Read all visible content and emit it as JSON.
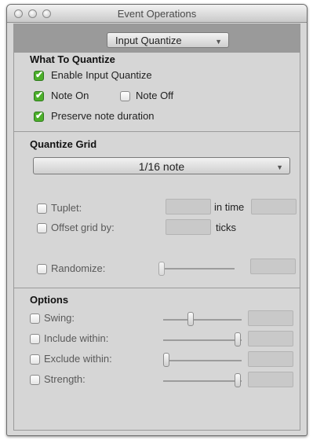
{
  "window": {
    "title": "Event Operations"
  },
  "operation": {
    "selected": "Input Quantize"
  },
  "what_to_quantize": {
    "title": "What To Quantize",
    "enable_input_quantize": {
      "label": "Enable Input Quantize",
      "checked": true
    },
    "note_on": {
      "label": "Note On",
      "checked": true
    },
    "note_off": {
      "label": "Note Off",
      "checked": false
    },
    "preserve_note_duration": {
      "label": "Preserve note duration",
      "checked": true
    }
  },
  "quantize_grid": {
    "title": "Quantize Grid",
    "grid_value": "1/16 note",
    "tuplet": {
      "label": "Tuplet:",
      "checked": false,
      "in_time_label": "in time"
    },
    "offset_grid": {
      "label": "Offset grid by:",
      "checked": false,
      "units": "ticks"
    },
    "randomize": {
      "label": "Randomize:",
      "checked": false
    }
  },
  "options": {
    "title": "Options",
    "swing": {
      "label": "Swing:",
      "checked": false
    },
    "include_within": {
      "label": "Include within:",
      "checked": false
    },
    "exclude_within": {
      "label": "Exclude within:",
      "checked": false
    },
    "strength": {
      "label": "Strength:",
      "checked": false
    }
  },
  "icons": {
    "checkmark": "✔",
    "popup_arrow": "▼"
  },
  "colors": {
    "check_green": "#4caf2a",
    "panel": "#d6d6d6",
    "strip": "#9a9a9a"
  }
}
